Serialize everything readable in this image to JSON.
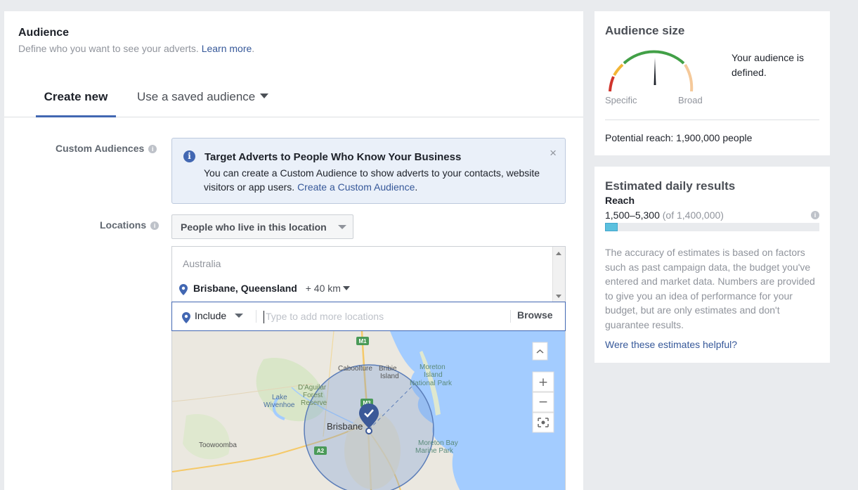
{
  "audience": {
    "title": "Audience",
    "subtitle": "Define who you want to see your adverts.",
    "learn_more": "Learn more",
    "period": "."
  },
  "tabs": {
    "create_new": "Create new",
    "saved": "Use a saved audience"
  },
  "custom_audiences": {
    "label": "Custom Audiences",
    "notice_title": "Target Adverts to People Who Know Your Business",
    "notice_body": "You can create a Custom Audience to show adverts to your contacts, website visitors or app users.",
    "notice_link": "Create a Custom Audience",
    "notice_link_suffix": ".",
    "close_glyph": "×"
  },
  "locations": {
    "label": "Locations",
    "selector_value": "People who live in this location",
    "country": "Australia",
    "selected_location": "Brisbane, Queensland",
    "radius": "+ 40 km",
    "include_label": "Include",
    "input_placeholder": "Type to add more locations",
    "browse_label": "Browse"
  },
  "map": {
    "labels": {
      "brisbane": "Brisbane",
      "caboolture": "Caboolture",
      "bribie": "Bribie",
      "bribie2": "Island",
      "moreton1": "Moreton",
      "moreton2": "Island",
      "moreton3": "National Park",
      "daguilar1": "D'Aguilar",
      "daguilar2": "Forest",
      "daguilar3": "Reserve",
      "lake1": "Lake",
      "lake2": "Wivenhoe",
      "toowoomba": "Toowoomba",
      "marine1": "Moreton Bay",
      "marine2": "Marine Park",
      "m1": "M1",
      "m3": "M3",
      "a2": "A2"
    },
    "zoom_in": "+",
    "zoom_out": "−",
    "colors": {
      "water": "#a3ccff",
      "land": "#ebe8e0",
      "radius_fill": "#7fa0d6",
      "pin": "#3b5998"
    }
  },
  "audience_size": {
    "title": "Audience size",
    "specific": "Specific",
    "broad": "Broad",
    "status": "Your audience is defined.",
    "potential_reach": "Potential reach: 1,900,000 people"
  },
  "daily_results": {
    "title": "Estimated daily results",
    "reach_label": "Reach",
    "reach_range": "1,500–5,300",
    "reach_of": "(of 1,400,000)",
    "reach_fraction": 0.06,
    "accuracy_text": "The accuracy of estimates is based on factors such as past campaign data, the budget you've entered and market data. Numbers are provided to give you an idea of performance for your budget, but are only estimates and don't guarantee results.",
    "helpful_link": "Were these estimates helpful?"
  },
  "info_glyph": "i"
}
